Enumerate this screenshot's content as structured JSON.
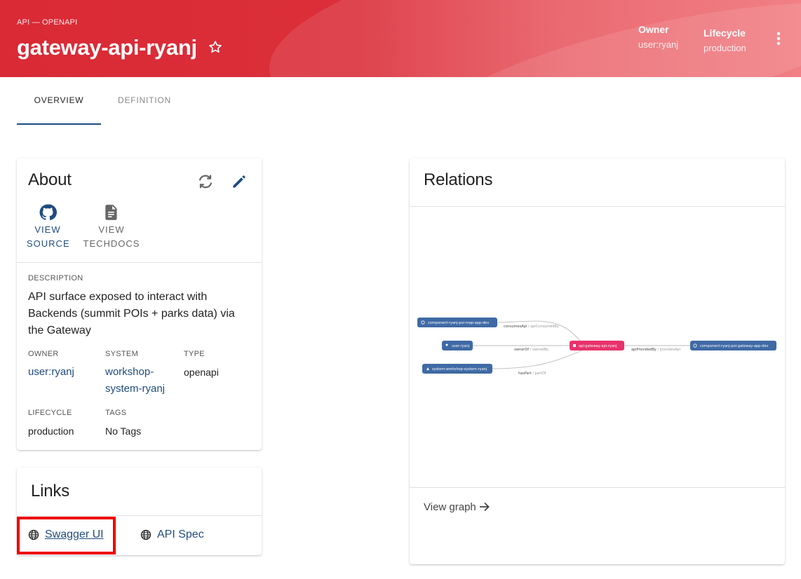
{
  "header": {
    "kicker": "API — OPENAPI",
    "title": "gateway-api-ryanj",
    "owner_label": "Owner",
    "owner_value": "user:ryanj",
    "lifecycle_label": "Lifecycle",
    "lifecycle_value": "production"
  },
  "tabs": [
    {
      "label": "OVERVIEW",
      "active": true
    },
    {
      "label": "DEFINITION",
      "active": false
    }
  ],
  "about": {
    "title": "About",
    "view_source": [
      "VIEW",
      "SOURCE"
    ],
    "view_techdocs": [
      "VIEW",
      "TECHDOCS"
    ],
    "description_label": "DESCRIPTION",
    "description": "API surface exposed to interact with Backends (summit POIs + parks data) via the Gateway",
    "owner_label": "OWNER",
    "owner_value": "user:ryanj",
    "system_label": "SYSTEM",
    "system_value_1": "workshop-",
    "system_value_2": "system-ryanj",
    "type_label": "TYPE",
    "type_value": "openapi",
    "lifecycle_label": "LIFECYCLE",
    "lifecycle_value": "production",
    "tags_label": "TAGS",
    "tags_value": "No Tags"
  },
  "links": {
    "title": "Links",
    "items": [
      {
        "label": "Swagger UI",
        "icon": "globe-icon"
      },
      {
        "label": "API Spec",
        "icon": "globe-icon"
      }
    ]
  },
  "relations": {
    "title": "Relations",
    "nodes": {
      "component_map": "component:ryanj-poi-map-app-dev",
      "user": "user:ryanj",
      "system": "system:workshop-system-ryanj",
      "api": "api:gateway-api-ryanj",
      "component_gateway": "component:ryanj-poi-gateway-app-dev"
    },
    "edges": {
      "consumes": "consumesApi",
      "consumes_rev": " / apiConsumedBy",
      "owner": "ownerOf",
      "owner_rev": " / ownedBy",
      "haspart": "hasPart",
      "haspart_rev": " / partOf",
      "provided": "apiProvidedBy",
      "provided_rev": " / providesApi"
    },
    "view_graph": "View graph"
  },
  "colors": {
    "header_red": "#d92a35",
    "link_blue": "#1f4c80",
    "node_blue": "#3f6aa5",
    "node_pink": "#e8336b",
    "highlight_red": "#ee0000"
  }
}
